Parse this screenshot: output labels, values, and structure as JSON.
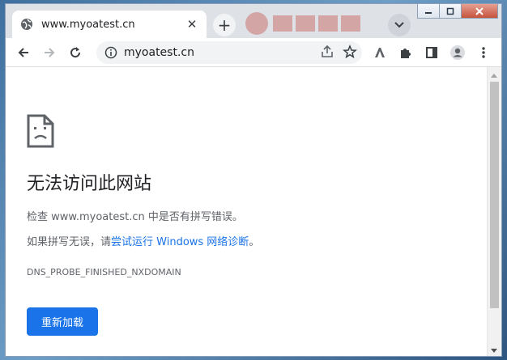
{
  "tab": {
    "title": "www.myoatest.cn",
    "close_glyph": "✕",
    "new_tab_glyph": "+"
  },
  "omnibox": {
    "url": "myoatest.cn"
  },
  "error_page": {
    "heading": "无法访问此网站",
    "check_text": "检查 www.myoatest.cn 中是否有拼写错误。",
    "suggestion_prefix": "如果拼写无误，请",
    "suggestion_link": "尝试运行 Windows 网络诊断",
    "suggestion_suffix": "。",
    "error_code": "DNS_PROBE_FINISHED_NXDOMAIN",
    "reload_label": "重新加载"
  },
  "icons": [
    "globe-icon",
    "close-icon",
    "new-tab-icon",
    "tab-search-icon",
    "minimize-icon",
    "maximize-icon",
    "window-close-icon",
    "back-icon",
    "forward-icon",
    "reload-icon",
    "info-icon",
    "share-icon",
    "bookmark-star-icon",
    "extension-a-icon",
    "extensions-puzzle-icon",
    "side-panel-icon",
    "profile-icon",
    "menu-icon",
    "sad-page-icon"
  ],
  "colors": {
    "accent": "#1a73e8",
    "text": "#202124",
    "muted": "#5f6368",
    "frame": "#dee1e6"
  }
}
